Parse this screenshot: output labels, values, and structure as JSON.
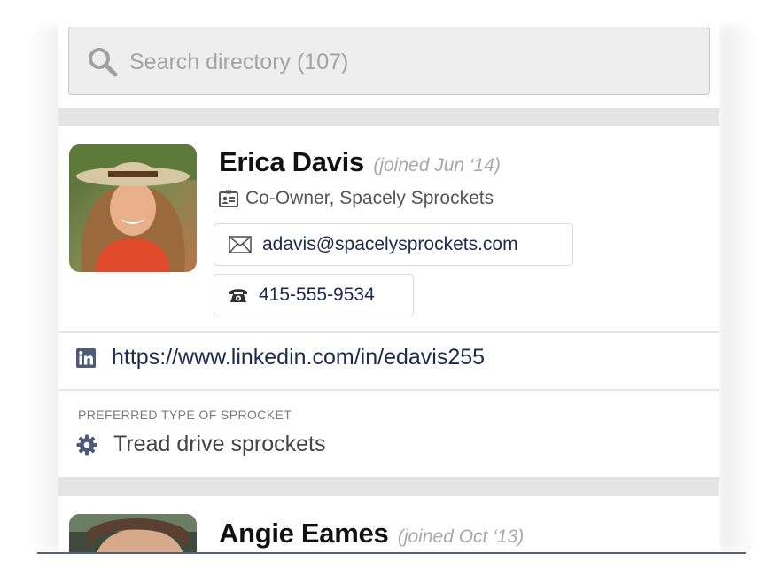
{
  "search": {
    "placeholder": "Search directory (107)"
  },
  "people": [
    {
      "name": "Erica Davis",
      "joined": "(joined Jun ‘14)",
      "role": "Co-Owner, Spacely Sprockets",
      "email": "adavis@spacelysprockets.com",
      "phone": "415-555-9534",
      "linkedin": "https://www.linkedin.com/in/edavis255",
      "preference_label": "PREFERRED TYPE OF SPROCKET",
      "preference_value": "Tread drive sprockets"
    },
    {
      "name": "Angie Eames",
      "joined": "(joined Oct ‘13)"
    }
  ],
  "icons": {
    "search": "search-icon",
    "role": "id-card-icon",
    "email": "envelope-icon",
    "phone": "telephone-icon",
    "linkedin": "linkedin-icon",
    "preference": "gear-icon"
  },
  "colors": {
    "link_text": "#1c2a4e",
    "muted_text": "#a8a8a8",
    "panel_bg": "#e4e4e4"
  }
}
